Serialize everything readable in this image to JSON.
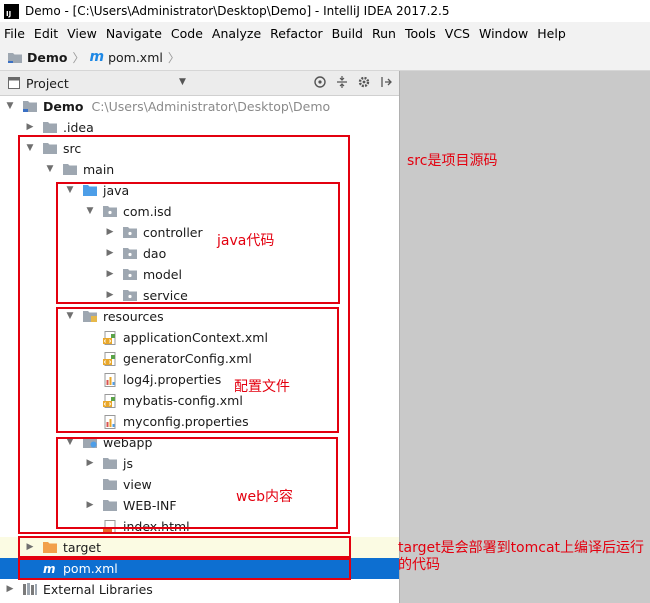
{
  "window": {
    "title": "Demo - [C:\\Users\\Administrator\\Desktop\\Demo] - IntelliJ IDEA 2017.2.5",
    "logo_text": "IJ"
  },
  "menu": [
    "File",
    "Edit",
    "View",
    "Navigate",
    "Code",
    "Analyze",
    "Refactor",
    "Build",
    "Run",
    "Tools",
    "VCS",
    "Window",
    "Help"
  ],
  "breadcrumb": {
    "project": "Demo",
    "file": "pom.xml",
    "file_icon": "m"
  },
  "panel": {
    "title": "Project",
    "tools": [
      "target-icon",
      "collapse-icon",
      "gear-icon",
      "hide-icon"
    ]
  },
  "tree": [
    {
      "label": "Demo",
      "path": "C:\\Users\\Administrator\\Desktop\\Demo",
      "depth": 0,
      "arrow": "expanded",
      "icon": "module-folder",
      "bold": true
    },
    {
      "label": ".idea",
      "depth": 1,
      "arrow": "collapsed",
      "icon": "folder"
    },
    {
      "label": "src",
      "depth": 1,
      "arrow": "expanded",
      "icon": "folder"
    },
    {
      "label": "main",
      "depth": 2,
      "arrow": "expanded",
      "icon": "folder"
    },
    {
      "label": "java",
      "depth": 3,
      "arrow": "expanded",
      "icon": "source-folder"
    },
    {
      "label": "com.isd",
      "depth": 4,
      "arrow": "expanded",
      "icon": "package"
    },
    {
      "label": "controller",
      "depth": 5,
      "arrow": "collapsed",
      "icon": "package"
    },
    {
      "label": "dao",
      "depth": 5,
      "arrow": "collapsed",
      "icon": "package"
    },
    {
      "label": "model",
      "depth": 5,
      "arrow": "collapsed",
      "icon": "package"
    },
    {
      "label": "service",
      "depth": 5,
      "arrow": "collapsed",
      "icon": "package"
    },
    {
      "label": "resources",
      "depth": 3,
      "arrow": "expanded",
      "icon": "resources-folder"
    },
    {
      "label": "applicationContext.xml",
      "depth": 4,
      "arrow": "none",
      "icon": "xml"
    },
    {
      "label": "generatorConfig.xml",
      "depth": 4,
      "arrow": "none",
      "icon": "xml"
    },
    {
      "label": "log4j.properties",
      "depth": 4,
      "arrow": "none",
      "icon": "properties"
    },
    {
      "label": "mybatis-config.xml",
      "depth": 4,
      "arrow": "none",
      "icon": "xml"
    },
    {
      "label": "myconfig.properties",
      "depth": 4,
      "arrow": "none",
      "icon": "properties"
    },
    {
      "label": "webapp",
      "depth": 3,
      "arrow": "expanded",
      "icon": "web-folder"
    },
    {
      "label": "js",
      "depth": 4,
      "arrow": "collapsed",
      "icon": "folder"
    },
    {
      "label": "view",
      "depth": 4,
      "arrow": "none",
      "icon": "folder"
    },
    {
      "label": "WEB-INF",
      "depth": 4,
      "arrow": "collapsed",
      "icon": "folder"
    },
    {
      "label": "index.html",
      "depth": 4,
      "arrow": "none",
      "icon": "html"
    },
    {
      "label": "target",
      "depth": 1,
      "arrow": "collapsed",
      "icon": "excluded-folder",
      "highlight": true
    },
    {
      "label": "pom.xml",
      "depth": 1,
      "arrow": "none",
      "icon": "maven",
      "selected": true
    },
    {
      "label": "External Libraries",
      "depth": 0,
      "arrow": "collapsed",
      "icon": "libraries"
    }
  ],
  "annotations": {
    "src": "src是项目源码",
    "java": "java代码",
    "resources": "配置文件",
    "webapp": "web内容",
    "target": "target是会部署到tomcat上编译后运行的代码"
  },
  "colors": {
    "annotation": "#e3000f",
    "selection": "#0d6fd1",
    "folder": "#9ea7b1",
    "source_folder": "#4d9ee8",
    "excluded_folder": "#f2a04b"
  }
}
